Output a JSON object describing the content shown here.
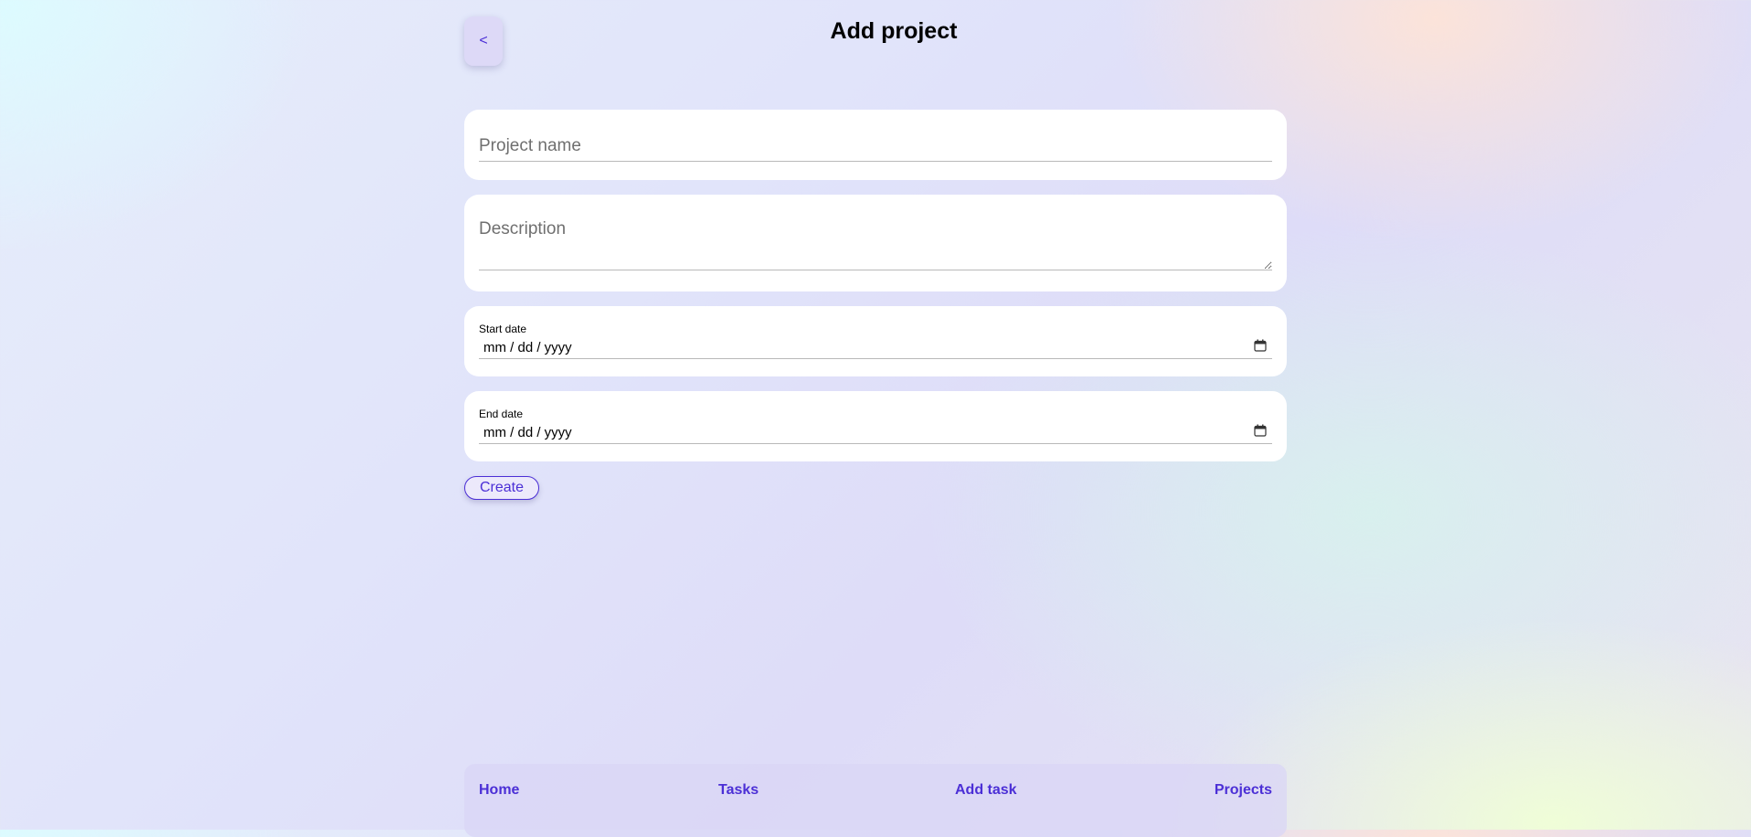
{
  "header": {
    "back_label": "<",
    "title": "Add project"
  },
  "form": {
    "project_name_placeholder": "Project name",
    "description_placeholder": "Description",
    "start_date_label": "Start date",
    "start_date_value": "mm / dd / yyyy",
    "end_date_label": "End date",
    "end_date_value": "mm / dd / yyyy",
    "create_label": "Create"
  },
  "nav": {
    "items": [
      {
        "label": "Home"
      },
      {
        "label": "Tasks"
      },
      {
        "label": "Add task"
      },
      {
        "label": "Projects"
      }
    ]
  },
  "colors": {
    "accent": "#4b2fd6",
    "card": "#ffffff"
  },
  "icons": {
    "calendar": "calendar-icon"
  }
}
